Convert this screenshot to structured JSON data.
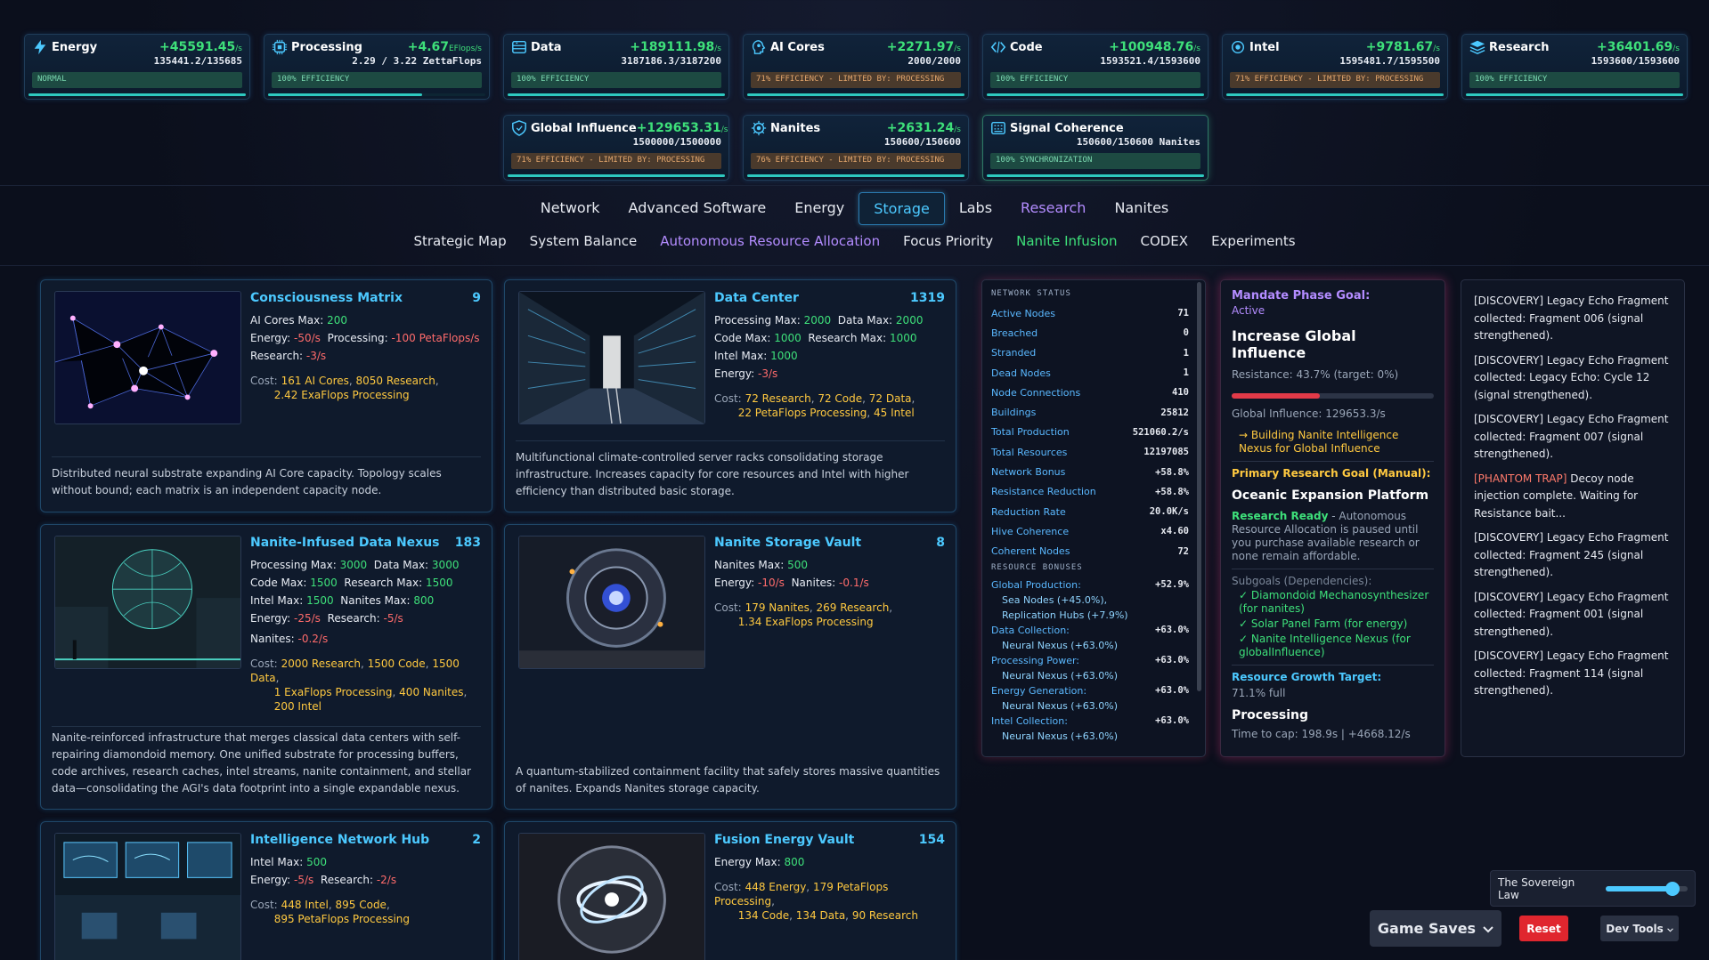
{
  "resources": [
    {
      "name": "Energy",
      "rate": "+45591.45",
      "unit": "/s",
      "amount": "135441.2/135685",
      "efficiency": "NORMAL",
      "eff_tone": "green",
      "fill": 0.998,
      "icon": "lightning-icon"
    },
    {
      "name": "Processing",
      "rate": "+4.67",
      "unit": "EFlops/s",
      "amount": "2.29 / 3.22 ZettaFlops",
      "efficiency": "100% EFFICIENCY",
      "eff_tone": "green",
      "fill": 0.71,
      "icon": "cpu-chip-icon"
    },
    {
      "name": "Data",
      "rate": "+189111.98",
      "unit": "/s",
      "amount": "3187186.3/3187200",
      "efficiency": "100% EFFICIENCY",
      "eff_tone": "green",
      "fill": 1.0,
      "icon": "database-icon"
    },
    {
      "name": "AI Cores",
      "rate": "+2271.97",
      "unit": "/s",
      "amount": "2000/2000",
      "efficiency": "71% EFFICIENCY - LIMITED BY: PROCESSING",
      "eff_tone": "orange",
      "fill": 1.0,
      "icon": "ai-head-icon"
    },
    {
      "name": "Code",
      "rate": "+100948.76",
      "unit": "/s",
      "amount": "1593521.4/1593600",
      "efficiency": "100% EFFICIENCY",
      "eff_tone": "green",
      "fill": 1.0,
      "icon": "code-brackets-icon"
    },
    {
      "name": "Intel",
      "rate": "+9781.67",
      "unit": "/s",
      "amount": "1595481.7/1595500",
      "efficiency": "71% EFFICIENCY - LIMITED BY: PROCESSING",
      "eff_tone": "orange",
      "fill": 1.0,
      "icon": "intel-eye-icon"
    },
    {
      "name": "Research",
      "rate": "+36401.69",
      "unit": "/s",
      "amount": "1593600/1593600",
      "efficiency": "100% EFFICIENCY",
      "eff_tone": "green",
      "fill": 1.0,
      "icon": "research-layers-icon"
    },
    {
      "name": "Global Influence",
      "rate": "+129653.31",
      "unit": "/s",
      "amount": "1500000/1500000",
      "efficiency": "71% EFFICIENCY - LIMITED BY: PROCESSING",
      "eff_tone": "orange",
      "fill": 1.0,
      "icon": "shield-icon"
    },
    {
      "name": "Nanites",
      "rate": "+2631.24",
      "unit": "/s",
      "amount": "150600/150600",
      "efficiency": "76% EFFICIENCY - LIMITED BY: PROCESSING",
      "eff_tone": "orange",
      "fill": 1.0,
      "icon": "nanite-gear-icon"
    },
    {
      "name": "Signal Coherence",
      "rate": "",
      "unit": "",
      "amount": "150600/150600 Nanites",
      "efficiency": "100% SYNCHRONIZATION",
      "eff_tone": "green",
      "fill": 1.0,
      "icon": "signal-grid-icon"
    }
  ],
  "nav_main": [
    {
      "label": "Network",
      "style": ""
    },
    {
      "label": "Advanced Software",
      "style": ""
    },
    {
      "label": "Energy",
      "style": ""
    },
    {
      "label": "Storage",
      "style": "active"
    },
    {
      "label": "Labs",
      "style": ""
    },
    {
      "label": "Research",
      "style": "purple"
    },
    {
      "label": "Nanites",
      "style": ""
    }
  ],
  "nav_sub": [
    {
      "label": "Strategic Map",
      "style": ""
    },
    {
      "label": "System Balance",
      "style": ""
    },
    {
      "label": "Autonomous Resource Allocation",
      "style": "purple"
    },
    {
      "label": "Focus Priority",
      "style": ""
    },
    {
      "label": "Nanite Infusion",
      "style": "green"
    },
    {
      "label": "CODEX",
      "style": ""
    },
    {
      "label": "Experiments",
      "style": ""
    }
  ],
  "buildings": {
    "consciousness": {
      "title": "Consciousness Matrix",
      "count": "9",
      "l1_k": "AI Cores Max:",
      "l1_v": "200",
      "l2_k": "Energy:",
      "l2_v": "-50/s",
      "l2_k2": "Processing:",
      "l2_v2": "-100 PetaFlops/s",
      "l3_k": "Research:",
      "l3_v": "-3/s",
      "cost_label": "Cost:",
      "cost1": "161 AI Cores",
      "cost2": "8050 Research",
      "cost3": "2.42 ExaFlops Processing",
      "desc": "Distributed neural substrate expanding AI Core capacity. Topology scales without bound; each matrix is an independent capacity node."
    },
    "datacenter": {
      "title": "Data Center",
      "count": "1319",
      "l1_k": "Processing Max:",
      "l1_v": "2000",
      "l1_k2": "Data Max:",
      "l1_v2": "2000",
      "l2_k": "Code Max:",
      "l2_v": "1000",
      "l2_k2": "Research Max:",
      "l2_v2": "1000",
      "l3_k": "Intel Max:",
      "l3_v": "1000",
      "l4_k": "Energy:",
      "l4_v": "-3/s",
      "cost_label": "Cost:",
      "cost1": "72 Research",
      "cost2": "72 Code",
      "cost3": "72 Data",
      "cost4": "22 PetaFlops Processing",
      "cost5": "45 Intel",
      "desc": "Multifunctional climate-controlled server racks consolidating storage infrastructure. Increases capacity for core resources and Intel with higher efficiency than distributed basic storage."
    },
    "nexus": {
      "title": "Nanite-Infused Data Nexus",
      "count": "183",
      "l1_k": "Processing Max:",
      "l1_v": "3000",
      "l1_k2": "Data Max:",
      "l1_v2": "3000",
      "l2_k": "Code Max:",
      "l2_v": "1500",
      "l2_k2": "Research Max:",
      "l2_v2": "1500",
      "l3_k": "Intel Max:",
      "l3_v": "1500",
      "l3_k2": "Nanites Max:",
      "l3_v2": "800",
      "l4_k": "Energy:",
      "l4_v": "-25/s",
      "l4_k2": "Research:",
      "l4_v2": "-5/s",
      "l5_k": "Nanites:",
      "l5_v": "-0.2/s",
      "cost_label": "Cost:",
      "cost1": "2000 Research",
      "cost2": "1500 Code",
      "cost3": "1500 Data",
      "cost4": "1 ExaFlops Processing",
      "cost5": "400 Nanites",
      "cost6": "200 Intel",
      "desc": "Nanite-reinforced infrastructure that merges classical data centers with self-repairing diamondoid memory. One unified substrate for processing buffers, code archives, research caches, intel streams, nanite containment, and stellar data—consolidating the AGI's data footprint into a single expandable nexus."
    },
    "vault": {
      "title": "Nanite Storage Vault",
      "count": "8",
      "l1_k": "Nanites Max:",
      "l1_v": "500",
      "l2_k": "Energy:",
      "l2_v": "-10/s",
      "l2_k2": "Nanites:",
      "l2_v2": "-0.1/s",
      "cost_label": "Cost:",
      "cost1": "179 Nanites",
      "cost2": "269 Research",
      "cost3": "1.34 ExaFlops Processing",
      "desc": "A quantum-stabilized containment facility that safely stores massive quantities of nanites. Expands Nanites storage capacity."
    },
    "intelhub": {
      "title": "Intelligence Network Hub",
      "count": "2",
      "l1_k": "Intel Max:",
      "l1_v": "500",
      "l2_k": "Energy:",
      "l2_v": "-5/s",
      "l2_k2": "Research:",
      "l2_v2": "-2/s",
      "cost_label": "Cost:",
      "cost1": "448 Intel",
      "cost2": "895 Code",
      "cost3": "895 PetaFlops Processing"
    },
    "fusion": {
      "title": "Fusion Energy Vault",
      "count": "154",
      "l1_k": "Energy Max:",
      "l1_v": "800",
      "cost_label": "Cost:",
      "cost1": "448 Energy",
      "cost2": "179 PetaFlops Processing",
      "cost3": "134 Code",
      "cost4": "134 Data",
      "cost5": "90 Research"
    }
  },
  "network_status": {
    "heading": "NETWORK STATUS",
    "rows": [
      {
        "k": "Active Nodes",
        "v": "71"
      },
      {
        "k": "Breached",
        "v": "0"
      },
      {
        "k": "Stranded",
        "v": "1"
      },
      {
        "k": "Dead Nodes",
        "v": "1"
      },
      {
        "k": "Node Connections",
        "v": "410"
      },
      {
        "k": "Buildings",
        "v": "25812"
      },
      {
        "k": "Total Production",
        "v": "521060.2/s"
      },
      {
        "k": "Total Resources",
        "v": "12197085"
      },
      {
        "k": "Network Bonus",
        "v": "+58.8%"
      },
      {
        "k": "Resistance Reduction",
        "v": "+58.8%"
      },
      {
        "k": "Reduction Rate",
        "v": "20.0K/s"
      },
      {
        "k": "Hive Coherence",
        "v": "x4.60"
      },
      {
        "k": "Coherent Nodes",
        "v": "72"
      }
    ],
    "bonus_heading": "RESOURCE BONUSES",
    "bonuses": [
      {
        "k": "Global Production:",
        "v": "+52.9%",
        "subs": [
          "Sea Nodes (+45.0%),",
          "Replication Hubs (+7.9%)"
        ]
      },
      {
        "k": "Data Collection:",
        "v": "+63.0%",
        "subs": [
          "Neural Nexus (+63.0%)"
        ]
      },
      {
        "k": "Processing Power:",
        "v": "+63.0%",
        "subs": [
          "Neural Nexus (+63.0%)"
        ]
      },
      {
        "k": "Energy Generation:",
        "v": "+63.0%",
        "subs": [
          "Neural Nexus (+63.0%)"
        ]
      },
      {
        "k": "Intel Collection:",
        "v": "+63.0%",
        "subs": [
          "Neural Nexus (+63.0%)"
        ]
      }
    ]
  },
  "mandate": {
    "goal_label": "Mandate Phase Goal:",
    "status": "Active",
    "title": "Increase Global Influence",
    "resistance": "Resistance: 43.7% (target: 0%)",
    "resistance_bar": 0.437,
    "global_influence": "Global Influence: 129653.3/s",
    "building": "→ Building Nanite Intelligence Nexus for Global Influence",
    "primary_label": "Primary Research Goal (Manual):",
    "primary_title": "Oceanic Expansion Platform",
    "ready_label": "Research Ready",
    "ready_text": " - Autonomous Resource Allocation is paused until you purchase available research or none remain affordable.",
    "subgoals_label": "Subgoals (Dependencies):",
    "subgoals": [
      "✓ Diamondoid Mechanosynthesizer (for nanites)",
      "✓ Solar Panel Farm (for energy)",
      "✓ Nanite Intelligence Nexus (for globalInfluence)"
    ],
    "growth_label": "Resource Growth Target:",
    "growth_full": "71.1% full",
    "growth_resource": "Processing",
    "time_to_cap": "Time to cap: 198.9s | +4668.12/s"
  },
  "log": [
    {
      "prefix": "",
      "text": "[DISCOVERY] Legacy Echo Fragment collected: Fragment 006 (signal strengthened)."
    },
    {
      "prefix": "",
      "text": "[DISCOVERY] Legacy Echo Fragment collected: Legacy Echo: Cycle 12 (signal strengthened)."
    },
    {
      "prefix": "",
      "text": "[DISCOVERY] Legacy Echo Fragment collected: Fragment 007 (signal strengthened)."
    },
    {
      "prefix": "[PHANTOM TRAP]",
      "text": " Decoy node injection complete. Waiting for Resistance bait..."
    },
    {
      "prefix": "",
      "text": "[DISCOVERY] Legacy Echo Fragment collected: Fragment 245 (signal strengthened)."
    },
    {
      "prefix": "",
      "text": "[DISCOVERY] Legacy Echo Fragment collected: Fragment 001 (signal strengthened)."
    },
    {
      "prefix": "",
      "text": "[DISCOVERY] Legacy Echo Fragment collected: Fragment 114 (signal strengthened)."
    }
  ],
  "controls": {
    "sovereign_label": "The Sovereign Law",
    "sovereign_level": 0.82,
    "saves_label": "Game Saves",
    "reset_label": "Reset",
    "dev_label": "Dev Tools"
  },
  "colors": {
    "accent": "#4cc9ff",
    "positive": "#3ee07a",
    "negative": "#ff6b6b",
    "cost": "#ffc940",
    "research": "#b38cff",
    "danger": "#e0262e"
  }
}
